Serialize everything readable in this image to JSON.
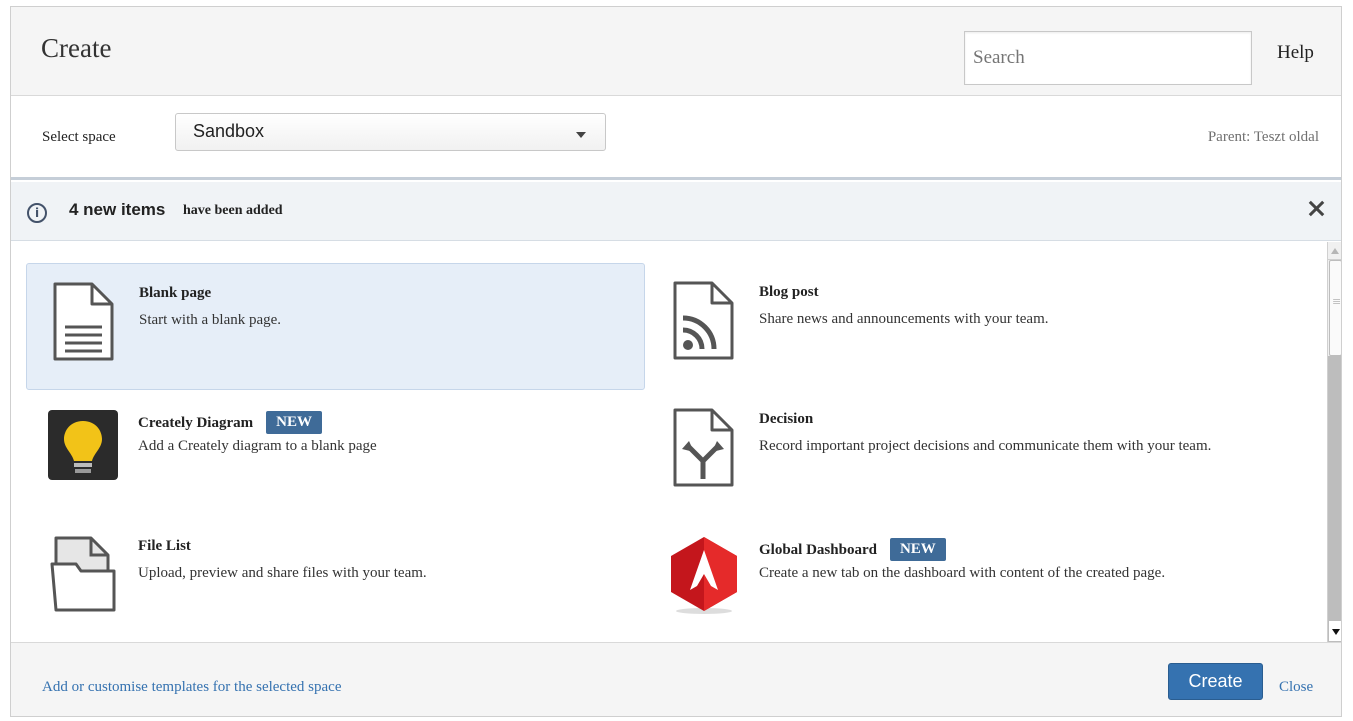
{
  "header": {
    "title": "Create",
    "search_placeholder": "Search",
    "help": "Help"
  },
  "space": {
    "label": "Select space",
    "selected": "Sandbox",
    "parent": "Parent: Teszt oldal"
  },
  "notice": {
    "count_text": "4 new items",
    "rest_text": "have been added"
  },
  "items": [
    {
      "name": "Blank page",
      "desc": "Start with a blank page.",
      "icon": "blank-page-icon"
    },
    {
      "name": "Blog post",
      "desc": "Share news and announcements with your team.",
      "icon": "blog-post-icon"
    },
    {
      "name": "Creately Diagram",
      "badge": "NEW",
      "desc": "Add a Creately diagram to a blank page",
      "icon": "lightbulb-icon"
    },
    {
      "name": "Decision",
      "desc": "Record important project decisions and communicate them with your team.",
      "icon": "decision-icon"
    },
    {
      "name": "File List",
      "desc": "Upload, preview and share files with your team.",
      "icon": "folder-icon"
    },
    {
      "name": "Global Dashboard",
      "badge": "NEW",
      "desc": "Create a new tab on the dashboard with content of the created page.",
      "icon": "global-dashboard-icon"
    }
  ],
  "footer": {
    "template_link": "Add or customise templates for the selected space",
    "create": "Create",
    "close": "Close"
  },
  "colors": {
    "accent": "#3572b0",
    "badge": "#3f6b98",
    "selected_bg": "#e6eef8"
  }
}
